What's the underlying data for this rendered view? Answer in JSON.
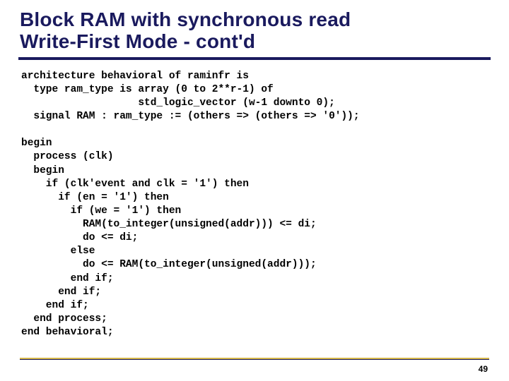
{
  "title_line1": "Block RAM with synchronous read",
  "title_line2": "Write-First Mode - cont'd",
  "code": "architecture behavioral of raminfr is\n  type ram_type is array (0 to 2**r-1) of\n                   std_logic_vector (w-1 downto 0);\n  signal RAM : ram_type := (others => (others => '0'));\n\nbegin\n  process (clk)\n  begin\n    if (clk'event and clk = '1') then\n      if (en = '1') then\n        if (we = '1') then\n          RAM(to_integer(unsigned(addr))) <= di;\n          do <= di;\n        else\n          do <= RAM(to_integer(unsigned(addr)));\n        end if;\n      end if;\n    end if;\n  end process;\nend behavioral;",
  "page_number": "49"
}
